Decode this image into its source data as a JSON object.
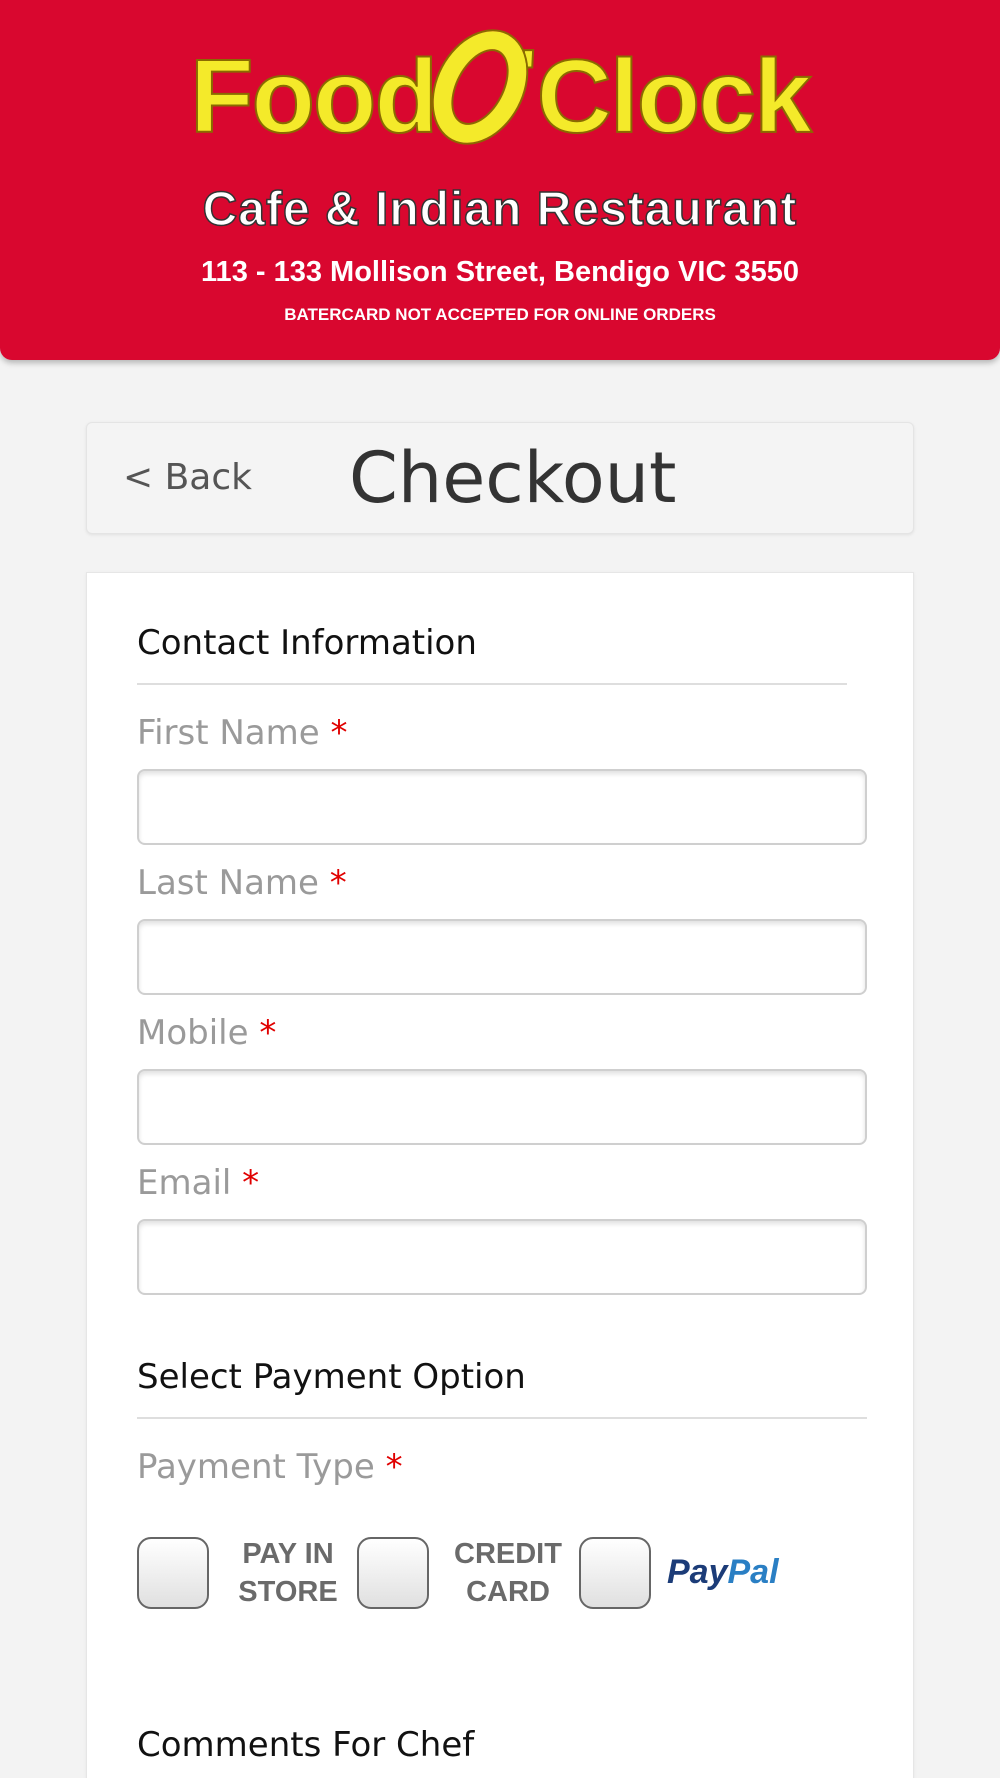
{
  "header": {
    "brand_left": "Food",
    "brand_apos": "'",
    "brand_right": "Clock",
    "subtitle": "Cafe & Indian Restaurant",
    "address": "113 - 133 Mollison Street, Bendigo VIC 3550",
    "notice": "BATERCARD NOT ACCEPTED FOR ONLINE ORDERS",
    "colors": {
      "background": "#d9072f",
      "brand": "#f4ea2a"
    }
  },
  "titlebar": {
    "back_label": "< Back",
    "title": "Checkout"
  },
  "contact": {
    "heading": "Contact Information",
    "fields": [
      {
        "label": "First Name",
        "required_mark": "*",
        "value": ""
      },
      {
        "label": "Last Name",
        "required_mark": "*",
        "value": ""
      },
      {
        "label": "Mobile",
        "required_mark": "*",
        "value": ""
      },
      {
        "label": "Email",
        "required_mark": "*",
        "value": ""
      }
    ]
  },
  "payment": {
    "heading": "Select Payment Option",
    "type_label": "Payment Type",
    "required_mark": "*",
    "options": [
      {
        "line1": "PAY IN",
        "line2": "STORE"
      },
      {
        "line1": "CREDIT",
        "line2": "CARD"
      },
      {
        "paypal_a": "Pay",
        "paypal_b": "Pal"
      }
    ]
  },
  "comments": {
    "heading": "Comments For Chef"
  }
}
